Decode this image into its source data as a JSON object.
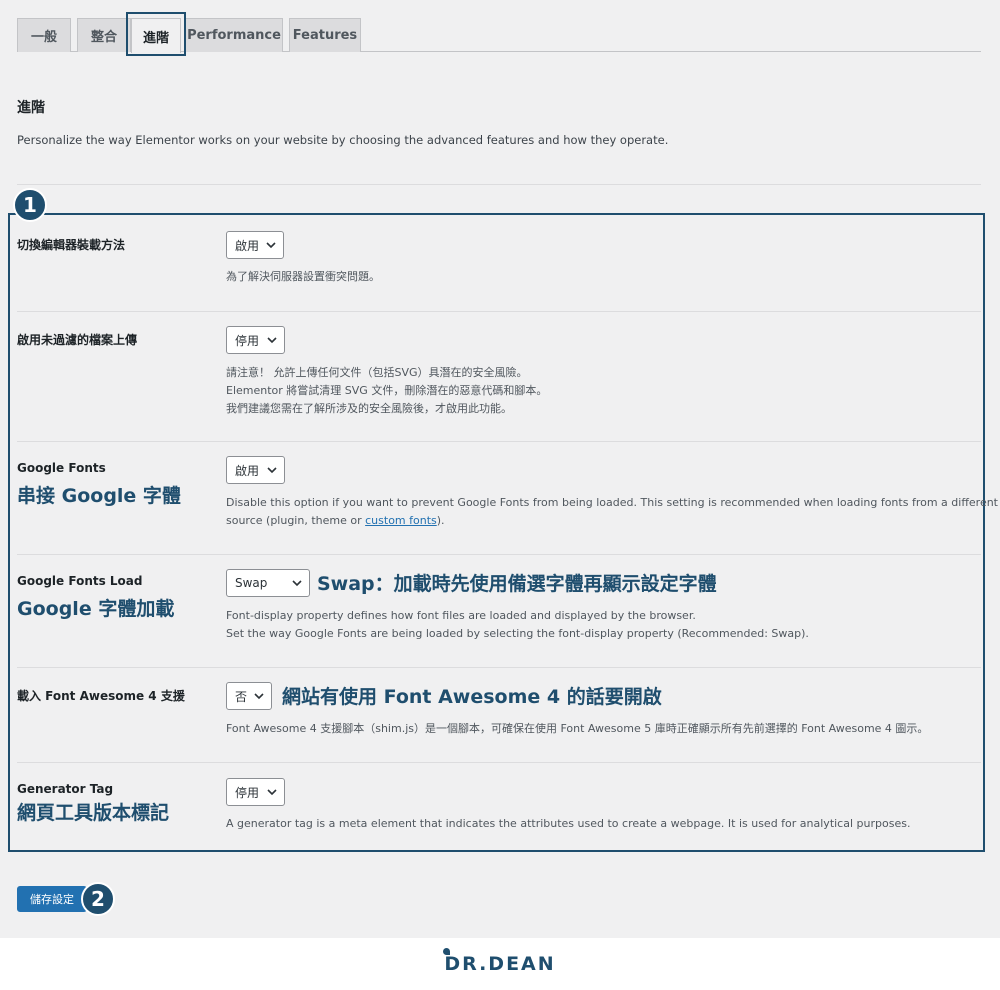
{
  "tabs": [
    {
      "label": "一般"
    },
    {
      "label": "整合"
    },
    {
      "label": "進階"
    },
    {
      "label": "Performance"
    },
    {
      "label": "Features"
    }
  ],
  "section": {
    "title": "進階",
    "description": "Personalize the way Elementor works on your website by choosing the advanced features and how they operate."
  },
  "badges": {
    "one": "1",
    "two": "2"
  },
  "rows": [
    {
      "label": "切換編輯器裝載方法",
      "annotation": "",
      "select": "啟用",
      "inline_annotation": "",
      "desc_lines": [
        "為了解決伺服器設置衝突問題。"
      ]
    },
    {
      "label": "啟用未過濾的檔案上傳",
      "annotation": "",
      "select": "停用",
      "inline_annotation": "",
      "desc_lines": [
        "請注意！ 允許上傳任何文件（包括SVG）具潛在的安全風險。",
        "Elementor 將嘗試清理 SVG 文件，刪除潛在的惡意代碼和腳本。",
        "我們建議您需在了解所涉及的安全風險後，才啟用此功能。"
      ]
    },
    {
      "label": "Google Fonts",
      "annotation": "串接 Google 字體",
      "select": "啟用",
      "inline_annotation": "",
      "desc_lines": [
        "Disable this option if you want to prevent Google Fonts from being loaded. This setting is recommended when loading fonts from a different"
      ],
      "desc_line2_prefix": "source (plugin, theme or ",
      "desc_link": "custom fonts",
      "desc_line2_suffix": ")."
    },
    {
      "label": "Google Fonts Load",
      "annotation": "Google 字體加載",
      "select": "Swap",
      "inline_annotation": "Swap：加載時先使用備選字體再顯示設定字體",
      "desc_lines": [
        "Font-display property defines how font files are loaded and displayed by the browser.",
        "Set the way Google Fonts are being loaded by selecting the font-display property (Recommended: Swap)."
      ]
    },
    {
      "label": "載入 Font Awesome 4 支援",
      "annotation": "",
      "select": "否",
      "inline_annotation": "網站有使用 Font Awesome 4 的話要開啟",
      "desc_lines": [
        "Font Awesome 4 支援腳本（shim.js）是一個腳本，可確保在使用 Font Awesome 5 庫時正確顯示所有先前選擇的 Font Awesome 4 圖示。"
      ]
    },
    {
      "label": "Generator Tag",
      "annotation": "網頁工具版本標記",
      "select": "停用",
      "inline_annotation": "",
      "desc_lines": [
        "A generator tag is a meta element that indicates the attributes used to create a webpage. It is used for analytical purposes."
      ]
    }
  ],
  "save_button": "儲存設定",
  "footer": {
    "logo": "DR.DEAN"
  },
  "colors": {
    "accent": "#1f4e6e",
    "button": "#2271b1",
    "link": "#2271b1"
  }
}
